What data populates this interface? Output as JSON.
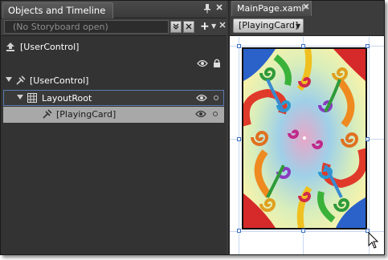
{
  "objects_panel": {
    "title": "Objects and Timeline",
    "pin_icon": "pin-icon",
    "close_icon": "close-icon",
    "storyboard": {
      "placeholder": "(No Storyboard open)",
      "add_label": "+"
    },
    "tree": {
      "root_usercontrol": "[UserControl]",
      "usercontrol_node": "[UserControl]",
      "layoutroot_node": "LayoutRoot",
      "playingcard_node": "[PlayingCard]"
    }
  },
  "document": {
    "tab_label": "MainPage.xaml*",
    "breadcrumb": "[PlayingCard]"
  },
  "colors": {
    "panel_bg": "#333333",
    "selection_border": "#5a7bb0",
    "child_selected_bg": "#a8a8a8",
    "handle_border": "#3b6fc4"
  }
}
